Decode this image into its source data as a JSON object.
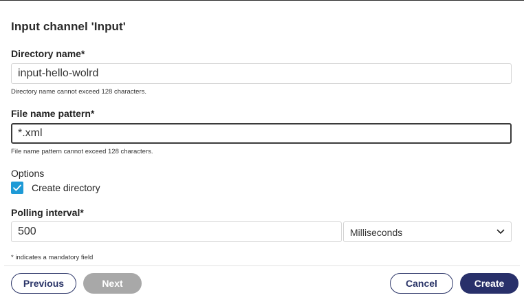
{
  "dialog": {
    "title": "Input channel 'Input'"
  },
  "fields": {
    "directory": {
      "label": "Directory name*",
      "value": "input-hello-wolrd",
      "help": "Directory name cannot exceed 128 characters."
    },
    "pattern": {
      "label": "File name pattern*",
      "value": "*.xml",
      "help": "File name pattern cannot exceed 128 characters."
    },
    "options": {
      "label": "Options",
      "create_directory_label": "Create directory",
      "create_directory_checked": true
    },
    "polling": {
      "label": "Polling interval*",
      "value": "500",
      "unit": "Milliseconds"
    }
  },
  "mandatory_note": "* indicates a mandatory field",
  "footer": {
    "previous": "Previous",
    "next": "Next",
    "cancel": "Cancel",
    "create": "Create"
  },
  "colors": {
    "checkbox": "#1e9ad6",
    "primary_button": "#28306a",
    "disabled_button": "#a8a8a8"
  },
  "icons": {
    "checkbox": "checkmark-icon",
    "select": "chevron-down-icon"
  }
}
